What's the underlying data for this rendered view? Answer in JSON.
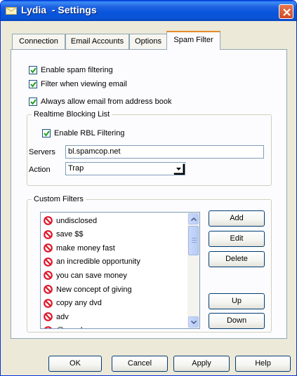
{
  "window": {
    "title": "Lydia  - Settings",
    "icon": "envelope-icon",
    "close_icon": "close-icon"
  },
  "tabs": [
    {
      "label": "Connection",
      "active": false
    },
    {
      "label": "Email Accounts",
      "active": false
    },
    {
      "label": "Options",
      "active": false
    },
    {
      "label": "Spam Filter",
      "active": true
    }
  ],
  "spam": {
    "enable_spam": {
      "label": "Enable spam filtering",
      "checked": true
    },
    "filter_viewing": {
      "label": "Filter when viewing email",
      "checked": true
    },
    "always_allow": {
      "label": "Always allow email from address book",
      "checked": true
    }
  },
  "rbl": {
    "legend": "Realtime Blocking List",
    "enable": {
      "label": "Enable RBL Filtering",
      "checked": true
    },
    "servers_label": "Servers",
    "servers_value": "bl.spamcop.net",
    "action_label": "Action",
    "action_value": "Trap"
  },
  "custom": {
    "legend": "Custom Filters",
    "items": [
      "undisclosed",
      "save $$",
      "make money fast",
      "an incredible opportunity",
      "you can save money",
      "New concept of giving",
      "copy any dvd",
      "adv",
      "@spool"
    ],
    "buttons": {
      "add": "Add",
      "edit": "Edit",
      "delete": "Delete",
      "up": "Up",
      "down": "Down"
    }
  },
  "footer": {
    "ok": "OK",
    "cancel": "Cancel",
    "apply": "Apply",
    "help": "Help"
  },
  "colors": {
    "titlebar": "#0855dd",
    "dialog_bg": "#ece9d8",
    "panel_bg": "#fcfcfe",
    "no_icon": "#e0162b",
    "active_tab_accent": "#e68b2c"
  }
}
